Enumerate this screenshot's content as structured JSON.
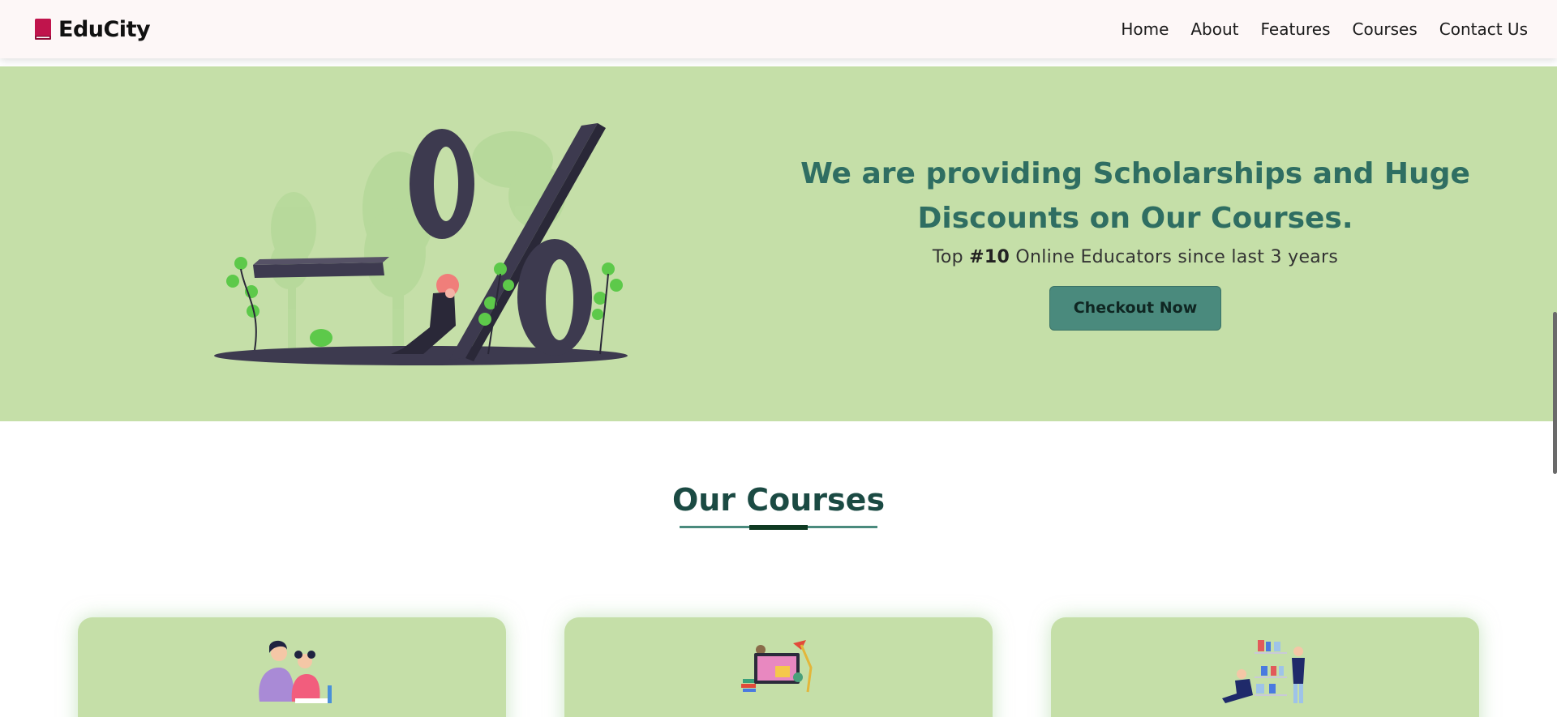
{
  "brand": {
    "name": "EduCity"
  },
  "nav": {
    "items": [
      "Home",
      "About",
      "Features",
      "Courses",
      "Contact Us"
    ]
  },
  "promo": {
    "title_line1": "We are providing Scholarships and Huge",
    "title_line2": "Discounts on Our Courses.",
    "sub_prefix": "Top ",
    "sub_highlight": "#10",
    "sub_suffix": " Online Educators since last 3 years",
    "cta_label": "Checkout Now",
    "illustration_text": "-%"
  },
  "courses": {
    "title": "Our Courses",
    "cards": [
      {
        "icon": "students-studying-icon"
      },
      {
        "icon": "online-learning-desk-icon"
      },
      {
        "icon": "library-bookshelf-icon"
      }
    ]
  },
  "colors": {
    "accent": "#4a8a7d",
    "heading": "#2f6e62",
    "promo_bg": "#c5dfa8",
    "brand_red": "#c0144c"
  }
}
